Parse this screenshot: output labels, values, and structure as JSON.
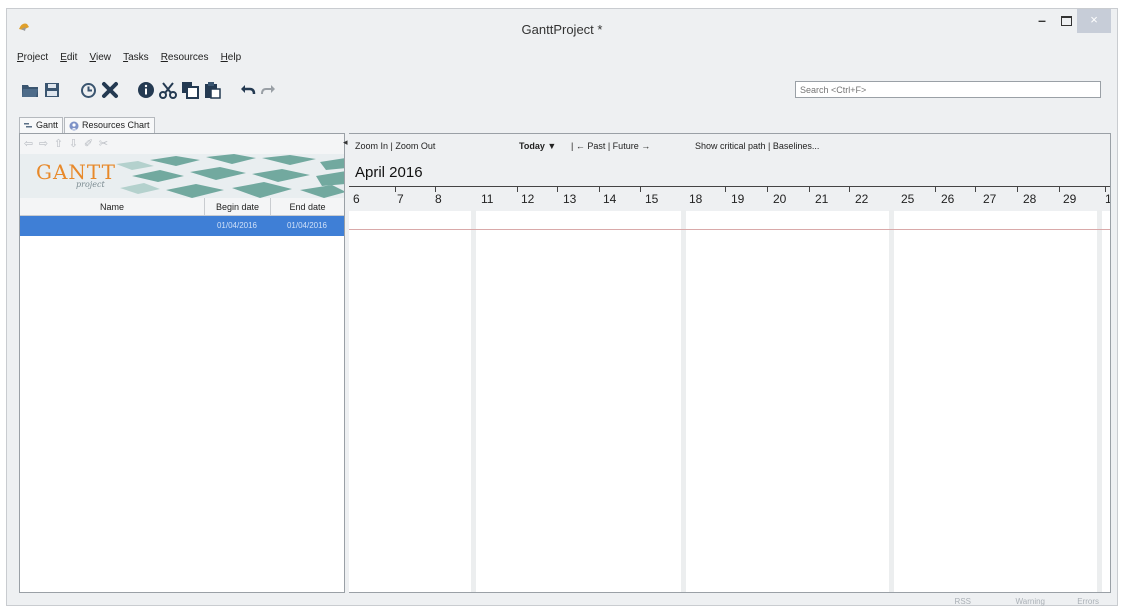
{
  "window": {
    "title": "GanttProject *"
  },
  "window_controls": {
    "minimize": "–",
    "close": "×"
  },
  "menu": [
    "Project",
    "Edit",
    "View",
    "Tasks",
    "Resources",
    "Help"
  ],
  "toolbar": {
    "search_placeholder": "Search <Ctrl+F>"
  },
  "icons": [
    "open-icon",
    "save-icon",
    "clock-icon",
    "delete-icon",
    "info-icon",
    "cut-icon",
    "copy-icon",
    "paste-icon",
    "undo-icon",
    "redo-icon"
  ],
  "tabs": [
    {
      "label": "Gantt",
      "icon": "gantt-tab-icon"
    },
    {
      "label": "Resources Chart",
      "icon": "people-icon"
    }
  ],
  "logo": {
    "text": "GANTT",
    "sub": "project"
  },
  "task_table": {
    "columns": [
      "Name",
      "Begin date",
      "End date"
    ],
    "rows": [
      {
        "name": "",
        "begin": "01/04/2016",
        "end": "01/04/2016"
      }
    ]
  },
  "chart_toolbar": {
    "zoom": "Zoom In | Zoom Out",
    "today": "Today ▼",
    "past_future": "| ← Past | Future →",
    "critical": "Show critical path | Baselines..."
  },
  "timeline": {
    "month": "April 2016",
    "days": [
      "6",
      "7",
      "8",
      "11",
      "12",
      "13",
      "14",
      "15",
      "18",
      "19",
      "20",
      "21",
      "22",
      "25",
      "26",
      "27",
      "28",
      "29",
      "1"
    ]
  },
  "status": {
    "rss": "RSS",
    "warning": "Warning",
    "errors": "Errors"
  },
  "colors": {
    "selection": "#3f7fd6",
    "logo_orange": "#e8892a",
    "logo_teal": "#5e9d92"
  }
}
